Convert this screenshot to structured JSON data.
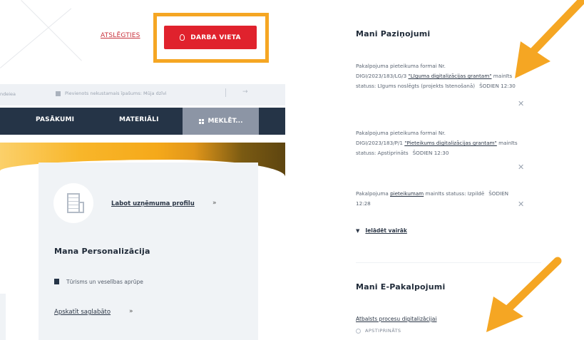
{
  "header": {
    "logout_label": "ATSLĒGTIES",
    "workplace_button_label": "DARBA VIETA"
  },
  "infobar": {
    "left_text": "ndeiea",
    "mid_text": "Pievienots nekustamais īpašums: Mūja dzīvi",
    "arrow": "→"
  },
  "nav": {
    "items": [
      "PASĀKUMI",
      "MATERIĀLI"
    ],
    "search_label": "MEKLĒT..."
  },
  "profile": {
    "edit_link": "Labot uzņēmuma profilu",
    "chevron": "»",
    "personalization_title": "Mana Personalizācija",
    "interest": "Tūrisms un veselības aprūpe",
    "view_saved": "Apskatīt saglabāto",
    "view_saved_chevron": "»"
  },
  "notifications": {
    "title": "Mani Paziņojumi",
    "items": [
      {
        "line1": "Pakalpojuma pieteikuma formai Nr.",
        "line2_prefix": "DIGI/2023/183/LG/3 ",
        "link": "\"Līguma digitalizācijas grantam\"",
        "line_rest": " mainīts statuss: Līgums noslēgts (projekts īstenošanā)",
        "time": "ŠODIEN 12:30"
      },
      {
        "line1": "Pakalpojuma pieteikuma formai Nr.",
        "line2_prefix": "DIGI/2023/183/P/1 ",
        "link": "\"Pieteikums digitalizācijas grantam\"",
        "line_rest": " mainīts statuss: Apstiprināts",
        "time": "ŠODIEN 12:30"
      },
      {
        "line1_prefix": "Pakalpojuma ",
        "link": "pieteikumam",
        "line_rest": " mainīts statuss: Izpildē",
        "time": "ŠODIEN 12:28"
      }
    ],
    "close_glyph": "✕",
    "load_more": "Ielādēt vairāk",
    "load_more_icon": "▼"
  },
  "eservices": {
    "title": "Mani E-Pakalpojumi",
    "link": "Atbalsts procesu digitalizācijai",
    "status": "APSTIPRINĀTS"
  },
  "colors": {
    "highlight": "#f5a623",
    "brand_red": "#e0222d",
    "nav_dark": "#253447",
    "arrow": "#f5a623"
  }
}
